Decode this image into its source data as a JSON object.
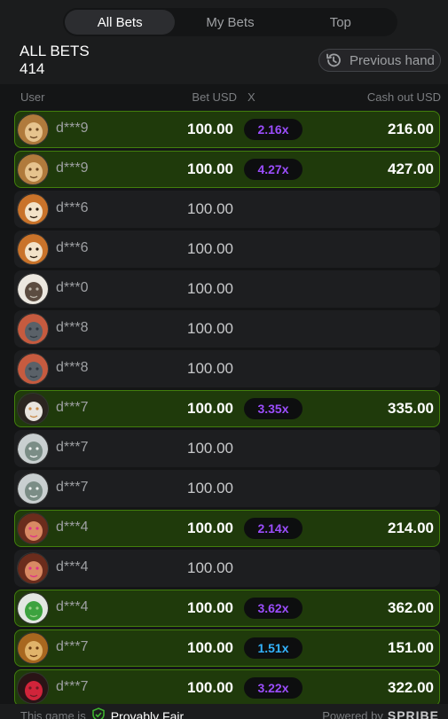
{
  "tabs": [
    {
      "label": "All Bets",
      "active": true
    },
    {
      "label": "My Bets",
      "active": false
    },
    {
      "label": "Top",
      "active": false
    }
  ],
  "header": {
    "title": "ALL BETS",
    "count": "414",
    "previous_hand_label": "Previous hand"
  },
  "columns": {
    "user": "User",
    "bet": "Bet USD",
    "x": "X",
    "cashout": "Cash out USD"
  },
  "colors": {
    "won_bg": "#1f3a0b",
    "won_border": "#427f0c",
    "mult_purple": "#9b4dfc",
    "mult_blue": "#34b4ff"
  },
  "rows": [
    {
      "user": "d***9",
      "avatar": "lion",
      "bet": "100.00",
      "x": "2.16x",
      "cashout": "216.00",
      "won": true,
      "mult_color": "purple"
    },
    {
      "user": "d***9",
      "avatar": "lion",
      "bet": "100.00",
      "x": "4.27x",
      "cashout": "427.00",
      "won": true,
      "mult_color": "purple"
    },
    {
      "user": "d***6",
      "avatar": "tiger",
      "bet": "100.00",
      "x": "",
      "cashout": "",
      "won": false
    },
    {
      "user": "d***6",
      "avatar": "tiger",
      "bet": "100.00",
      "x": "",
      "cashout": "",
      "won": false
    },
    {
      "user": "d***0",
      "avatar": "bird",
      "bet": "100.00",
      "x": "",
      "cashout": "",
      "won": false
    },
    {
      "user": "d***8",
      "avatar": "dragon",
      "bet": "100.00",
      "x": "",
      "cashout": "",
      "won": false
    },
    {
      "user": "d***8",
      "avatar": "dragon",
      "bet": "100.00",
      "x": "",
      "cashout": "",
      "won": false
    },
    {
      "user": "d***7",
      "avatar": "dog",
      "bet": "100.00",
      "x": "3.35x",
      "cashout": "335.00",
      "won": true,
      "mult_color": "purple"
    },
    {
      "user": "d***7",
      "avatar": "money",
      "bet": "100.00",
      "x": "",
      "cashout": "",
      "won": false
    },
    {
      "user": "d***7",
      "avatar": "money",
      "bet": "100.00",
      "x": "",
      "cashout": "",
      "won": false
    },
    {
      "user": "d***4",
      "avatar": "baby",
      "bet": "100.00",
      "x": "2.14x",
      "cashout": "214.00",
      "won": true,
      "mult_color": "purple"
    },
    {
      "user": "d***4",
      "avatar": "baby",
      "bet": "100.00",
      "x": "",
      "cashout": "",
      "won": false
    },
    {
      "user": "d***4",
      "avatar": "clover",
      "bet": "100.00",
      "x": "3.62x",
      "cashout": "362.00",
      "won": true,
      "mult_color": "purple"
    },
    {
      "user": "d***7",
      "avatar": "cat",
      "bet": "100.00",
      "x": "1.51x",
      "cashout": "151.00",
      "won": true,
      "mult_color": "blue"
    },
    {
      "user": "d***7",
      "avatar": "car",
      "bet": "100.00",
      "x": "3.22x",
      "cashout": "322.00",
      "won": true,
      "mult_color": "purple"
    }
  ],
  "footer": {
    "game_is": "This game is",
    "provably_fair": "Provably Fair",
    "powered_by": "Powered by",
    "brand": "SPRIBE"
  }
}
